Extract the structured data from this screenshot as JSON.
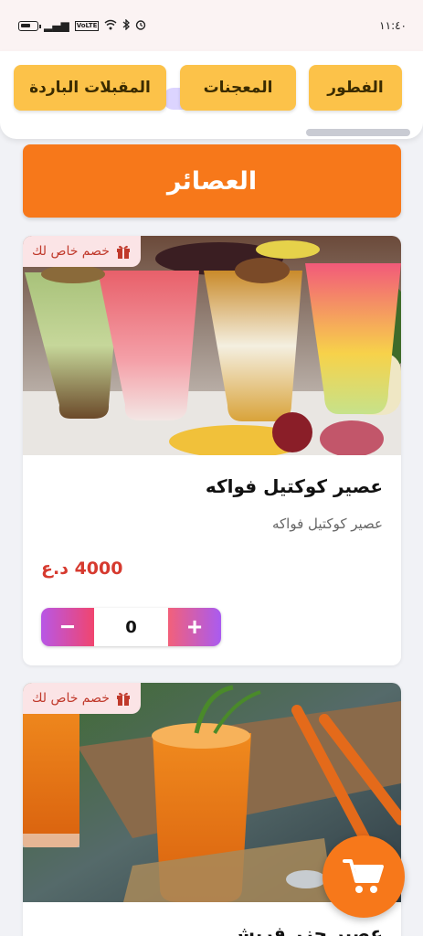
{
  "status_bar": {
    "time": "١١:٤٠",
    "volte": "VoLTE",
    "icons": [
      "battery-icon",
      "signal-icon",
      "volte-icon",
      "wifi-icon",
      "bluetooth-icon",
      "alarm-icon"
    ]
  },
  "categories": [
    {
      "label": "الفطور",
      "icon": "breakfast"
    },
    {
      "label": "المعجنات",
      "icon": "pastries"
    },
    {
      "label": "المقبلات الباردة",
      "icon": "cold-appetizers"
    }
  ],
  "section": {
    "title": "العصائر"
  },
  "products": [
    {
      "badge": "خصم خاص لك",
      "name": "عصير كوكتيل فواكه",
      "description": "عصير كوكتيل فواكه",
      "price": "4000 د.ع",
      "quantity": "0",
      "image": "fruit-cocktail-juice-photo"
    },
    {
      "badge": "خصم خاص لك",
      "name": "عصير جزر فريش",
      "image": "carrot-juice-photo"
    }
  ],
  "quantity_controls": {
    "minus": "−",
    "plus": "+"
  },
  "cart": {
    "icon": "cart-icon"
  },
  "colors": {
    "accent_orange": "#f7781a",
    "category_yellow": "#fcc249",
    "price_red": "#d63a2f",
    "badge_bg": "#fbe4e6",
    "stepper_gradient_start": "#b857e6",
    "stepper_gradient_end": "#f0456f"
  }
}
